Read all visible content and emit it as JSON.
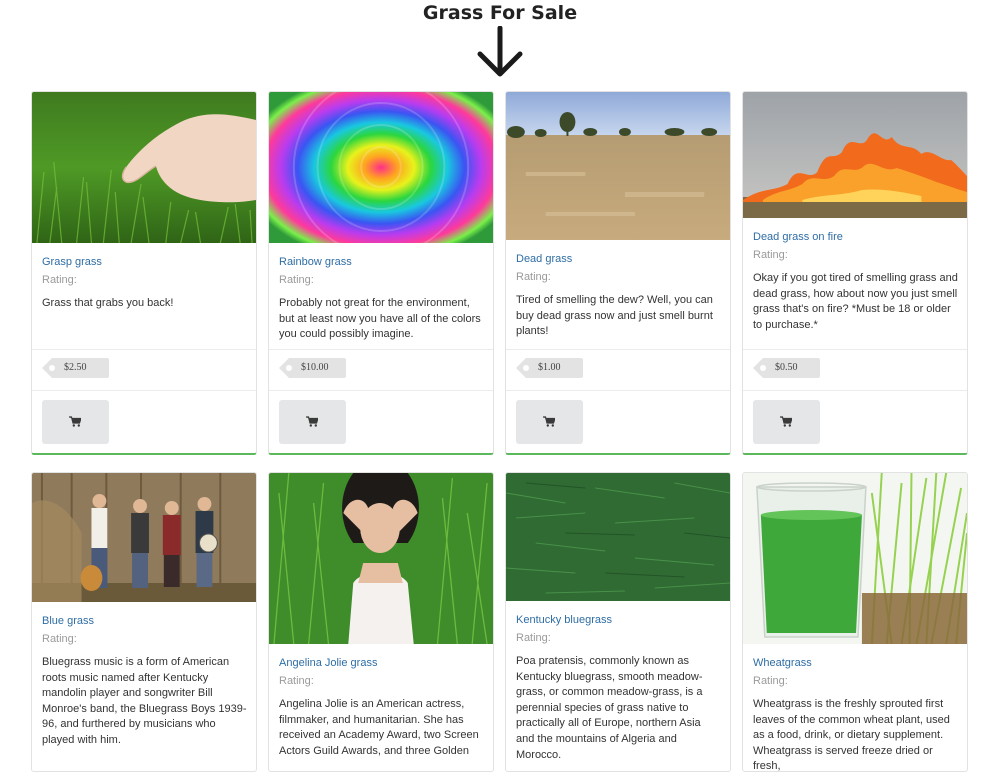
{
  "page": {
    "title": "Grass For Sale",
    "icons": {
      "arrow": "arrow-down-icon",
      "cart": "cart-icon",
      "price_tag": "price-tag-icon"
    }
  },
  "products": [
    {
      "name": "Grasp grass",
      "rating_label": "Rating:",
      "description": "Grass that grabs you back!",
      "price": "$2.50",
      "image": "hand-in-grass-photo"
    },
    {
      "name": "Rainbow grass",
      "rating_label": "Rating:",
      "description": "Probably not great for the environment, but at least now you have all of the colors you could possibly imagine.",
      "price": "$10.00",
      "image": "rainbow-grass-photo"
    },
    {
      "name": "Dead grass",
      "rating_label": "Rating:",
      "description": "Tired of smelling the dew? Well, you can buy dead grass now and just smell burnt plants!",
      "price": "$1.00",
      "image": "dry-field-photo"
    },
    {
      "name": "Dead grass on fire",
      "rating_label": "Rating:",
      "description": "Okay if you got tired of smelling grass and dead grass, how about now you just smell grass that's on fire? *Must be 18 or older to purchase.*",
      "price": "$0.50",
      "image": "grass-fire-photo"
    },
    {
      "name": "Blue grass",
      "rating_label": "Rating:",
      "description": "Bluegrass music is a form of American roots music named after Kentucky mandolin player and songwriter Bill Monroe's band, the Bluegrass Boys 1939-96, and furthered by musicians who played with him.",
      "image": "bluegrass-band-photo"
    },
    {
      "name": "Angelina Jolie grass",
      "rating_label": "Rating:",
      "description": "Angelina Jolie is an American actress, filmmaker, and humanitarian. She has received an Academy Award, two Screen Actors Guild Awards, and three Golden",
      "image": "woman-in-grass-photo"
    },
    {
      "name": "Kentucky bluegrass",
      "rating_label": "Rating:",
      "description": "Poa pratensis, commonly known as Kentucky bluegrass, smooth meadow-grass, or common meadow-grass, is a perennial species of grass native to practically all of Europe, northern Asia and the mountains of Algeria and Morocco.",
      "image": "green-lawn-photo"
    },
    {
      "name": "Wheatgrass",
      "rating_label": "Rating:",
      "description": "Wheatgrass is the freshly sprouted first leaves of the common wheat plant, used as a food, drink, or dietary supplement. Wheatgrass is served freeze dried or fresh,",
      "image": "wheatgrass-juice-photo"
    }
  ]
}
